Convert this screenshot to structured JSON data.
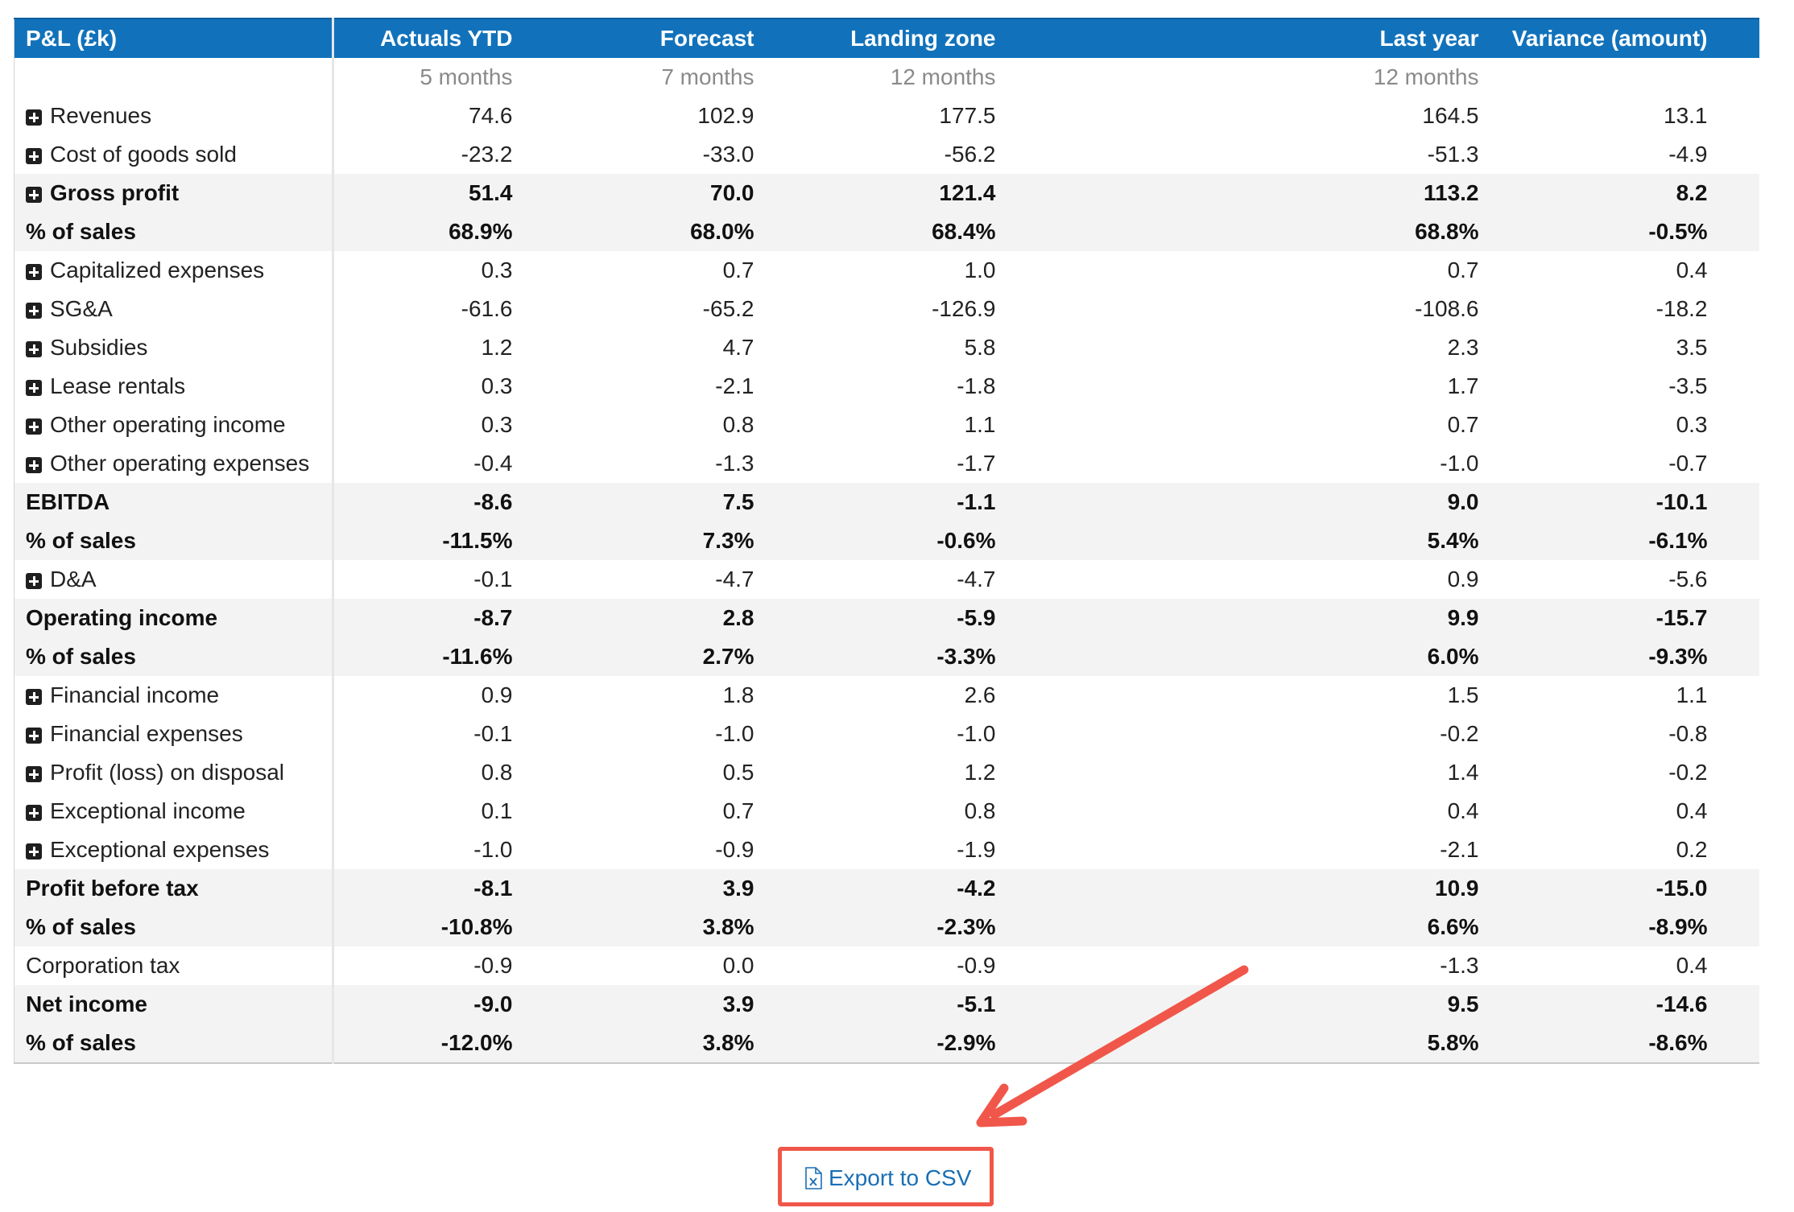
{
  "table": {
    "headers": {
      "label": "P&L (£k)",
      "actuals": "Actuals YTD",
      "forecast": "Forecast",
      "landing": "Landing zone",
      "spacer": "",
      "last": "Last year",
      "variance": "Variance (amount)"
    },
    "subheaders": {
      "label": "",
      "actuals": "5 months",
      "forecast": "7 months",
      "landing": "12 months",
      "spacer": "",
      "last": "12 months",
      "variance": ""
    },
    "rows": [
      {
        "label": "Revenues",
        "actuals": "74.6",
        "forecast": "102.9",
        "landing": "177.5",
        "last": "164.5",
        "variance": "13.1"
      },
      {
        "label": "Cost of goods sold",
        "actuals": "-23.2",
        "forecast": "-33.0",
        "landing": "-56.2",
        "last": "-51.3",
        "variance": "-4.9"
      },
      {
        "label": "Gross profit",
        "actuals": "51.4",
        "forecast": "70.0",
        "landing": "121.4",
        "last": "113.2",
        "variance": "8.2"
      },
      {
        "label": "% of sales",
        "actuals": "68.9%",
        "forecast": "68.0%",
        "landing": "68.4%",
        "last": "68.8%",
        "variance": "-0.5%"
      },
      {
        "label": "Capitalized expenses",
        "actuals": "0.3",
        "forecast": "0.7",
        "landing": "1.0",
        "last": "0.7",
        "variance": "0.4"
      },
      {
        "label": "SG&A",
        "actuals": "-61.6",
        "forecast": "-65.2",
        "landing": "-126.9",
        "last": "-108.6",
        "variance": "-18.2"
      },
      {
        "label": "Subsidies",
        "actuals": "1.2",
        "forecast": "4.7",
        "landing": "5.8",
        "last": "2.3",
        "variance": "3.5"
      },
      {
        "label": "Lease rentals",
        "actuals": "0.3",
        "forecast": "-2.1",
        "landing": "-1.8",
        "last": "1.7",
        "variance": "-3.5"
      },
      {
        "label": "Other operating income",
        "actuals": "0.3",
        "forecast": "0.8",
        "landing": "1.1",
        "last": "0.7",
        "variance": "0.3"
      },
      {
        "label": "Other operating expenses",
        "actuals": "-0.4",
        "forecast": "-1.3",
        "landing": "-1.7",
        "last": "-1.0",
        "variance": "-0.7"
      },
      {
        "label": "EBITDA",
        "actuals": "-8.6",
        "forecast": "7.5",
        "landing": "-1.1",
        "last": "9.0",
        "variance": "-10.1"
      },
      {
        "label": "% of sales",
        "actuals": "-11.5%",
        "forecast": "7.3%",
        "landing": "-0.6%",
        "last": "5.4%",
        "variance": "-6.1%"
      },
      {
        "label": "D&A",
        "actuals": "-0.1",
        "forecast": "-4.7",
        "landing": "-4.7",
        "last": "0.9",
        "variance": "-5.6"
      },
      {
        "label": "Operating income",
        "actuals": "-8.7",
        "forecast": "2.8",
        "landing": "-5.9",
        "last": "9.9",
        "variance": "-15.7"
      },
      {
        "label": "% of sales",
        "actuals": "-11.6%",
        "forecast": "2.7%",
        "landing": "-3.3%",
        "last": "6.0%",
        "variance": "-9.3%"
      },
      {
        "label": "Financial income",
        "actuals": "0.9",
        "forecast": "1.8",
        "landing": "2.6",
        "last": "1.5",
        "variance": "1.1"
      },
      {
        "label": "Financial expenses",
        "actuals": "-0.1",
        "forecast": "-1.0",
        "landing": "-1.0",
        "last": "-0.2",
        "variance": "-0.8"
      },
      {
        "label": "Profit (loss) on disposal",
        "actuals": "0.8",
        "forecast": "0.5",
        "landing": "1.2",
        "last": "1.4",
        "variance": "-0.2"
      },
      {
        "label": "Exceptional income",
        "actuals": "0.1",
        "forecast": "0.7",
        "landing": "0.8",
        "last": "0.4",
        "variance": "0.4"
      },
      {
        "label": "Exceptional expenses",
        "actuals": "-1.0",
        "forecast": "-0.9",
        "landing": "-1.9",
        "last": "-2.1",
        "variance": "0.2"
      },
      {
        "label": "Profit before tax",
        "actuals": "-8.1",
        "forecast": "3.9",
        "landing": "-4.2",
        "last": "10.9",
        "variance": "-15.0"
      },
      {
        "label": "% of sales",
        "actuals": "-10.8%",
        "forecast": "3.8%",
        "landing": "-2.3%",
        "last": "6.6%",
        "variance": "-8.9%"
      },
      {
        "label": "Corporation tax",
        "actuals": "-0.9",
        "forecast": "0.0",
        "landing": "-0.9",
        "last": "-1.3",
        "variance": "0.4"
      },
      {
        "label": "Net income",
        "actuals": "-9.0",
        "forecast": "3.9",
        "landing": "-5.1",
        "last": "9.5",
        "variance": "-14.6"
      },
      {
        "label": "% of sales",
        "actuals": "-12.0%",
        "forecast": "3.8%",
        "landing": "-2.9%",
        "last": "5.8%",
        "variance": "-8.6%"
      }
    ]
  },
  "export": {
    "label": "Export to CSV",
    "icon": "csv-file-icon"
  },
  "icons": {
    "expand": "plus-square-icon"
  },
  "colors": {
    "header_bg": "#1172bb",
    "header_text": "#ffffff",
    "shaded_row": "#f3f3f3",
    "link": "#1a6fb5",
    "annotation": "#f0574a"
  }
}
